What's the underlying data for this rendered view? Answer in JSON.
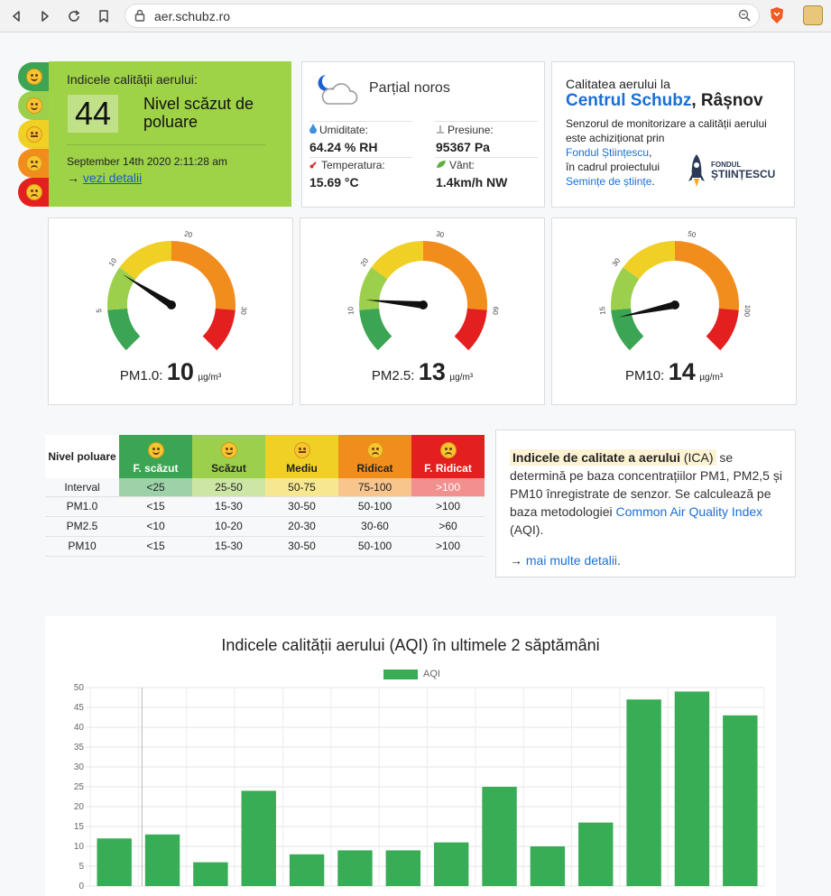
{
  "browser": {
    "url": "aer.schubz.ro"
  },
  "aqi": {
    "label": "Indicele calității aerului:",
    "value": "44",
    "level_text": "Nivel scăzut de poluare",
    "date": "September 14th 2020 2:11:28 am",
    "arrow": "→",
    "details_link": "vezi detalii"
  },
  "weather": {
    "condition": "Parțial noros",
    "humidity_label": "Umiditate:",
    "humidity": "64.24 % RH",
    "pressure_label": "Presiune:",
    "pressure": "95367 Pa",
    "temp_label": "Temperatura:",
    "temp": "15.69 °C",
    "wind_label": "Vânt:",
    "wind": "1.4km/h NW"
  },
  "info": {
    "line1": "Calitatea aerului la",
    "center": "Centrul Schubz",
    "city": ", Râșnov",
    "text1": "Senzorul de monitorizare a calității aerului este achiziționat prin",
    "link1": "Fondul Științescu",
    "text2": ",",
    "text3": "în cadrul proiectului",
    "link2": "Semințe de științe",
    "text4": ".",
    "logo_top": "FONDUL",
    "logo_bottom": "ȘTIINȚESCU"
  },
  "gauges": [
    {
      "name": "PM1.0:",
      "value": "10",
      "unit": "µg/m³",
      "max": 35,
      "ticks": [
        "0",
        "5",
        "10",
        "20",
        "30"
      ]
    },
    {
      "name": "PM2.5:",
      "value": "13",
      "unit": "µg/m³",
      "max": 70,
      "ticks": [
        "0",
        "10",
        "20",
        "30",
        "60"
      ]
    },
    {
      "name": "PM10:",
      "value": "14",
      "unit": "µg/m³",
      "max": 115,
      "ticks": [
        "0",
        "15",
        "30",
        "50",
        "100"
      ]
    }
  ],
  "table": {
    "corner": "Nivel poluare",
    "levels": [
      "F. scăzut",
      "Scăzut",
      "Mediu",
      "Ridicat",
      "F. Ridicat"
    ],
    "rows": [
      {
        "name": "Interval",
        "cells": [
          "<25",
          "25-50",
          "50-75",
          "75-100",
          ">100"
        ]
      },
      {
        "name": "PM1.0",
        "cells": [
          "<15",
          "15-30",
          "30-50",
          "50-100",
          ">100"
        ]
      },
      {
        "name": "PM2.5",
        "cells": [
          "<10",
          "10-20",
          "20-30",
          "30-60",
          ">60"
        ]
      },
      {
        "name": "PM10",
        "cells": [
          "<15",
          "15-30",
          "30-50",
          "50-100",
          ">100"
        ]
      }
    ],
    "colors": [
      "#3ba553",
      "#9ccf4b",
      "#f0d024",
      "#f18d1c",
      "#e41f1f"
    ],
    "interval_colors": [
      "#9dd2a9",
      "#cde6a5",
      "#f8e791",
      "#f8c58d",
      "#f28f8f"
    ]
  },
  "ica": {
    "highlight": "Indicele de calitate a aerului",
    "abbr": "(ICA)",
    "text1": "se determină pe baza concentrațiilor PM1, PM2,5 și PM10 înregistrate de senzor. Se calculează pe baza metodologiei",
    "link1": "Common Air Quality Index",
    "text2": "(AQI).",
    "arrow": "→",
    "link2": "mai multe detalii",
    "text3": "."
  },
  "chart_data": {
    "type": "bar",
    "title": "Indicele calității aerului (AQI) în ultimele 2 săptămâni",
    "series": [
      {
        "name": "AQI",
        "values": [
          12,
          13,
          6,
          24,
          8,
          9,
          9,
          11,
          25,
          10,
          16,
          47,
          49,
          43
        ],
        "color": "#38ad55"
      }
    ],
    "ylim": [
      0,
      50
    ],
    "yticks": [
      0,
      5,
      10,
      15,
      20,
      25,
      30,
      35,
      40,
      45,
      50
    ],
    "grid": true,
    "legend": "top"
  }
}
